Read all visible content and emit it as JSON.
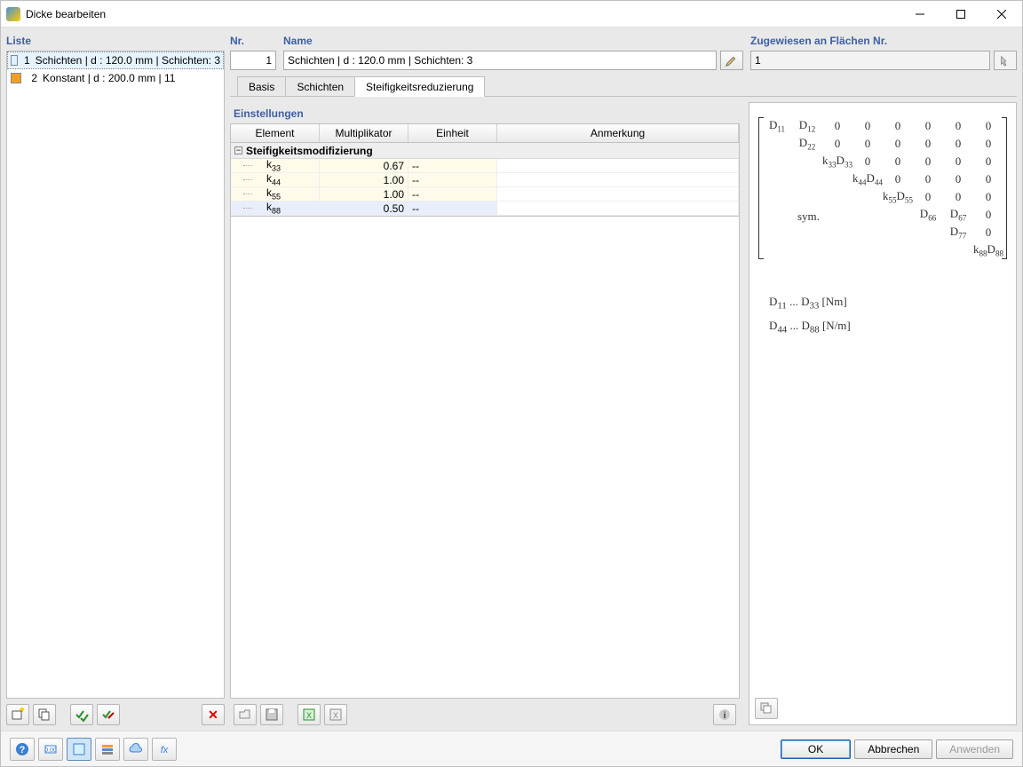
{
  "title": "Dicke bearbeiten",
  "left": {
    "header": "Liste",
    "items": [
      {
        "num": "1",
        "label": "Schichten | d : 120.0 mm | Schichten: 3",
        "color": "blue",
        "selected": true
      },
      {
        "num": "2",
        "label": "Konstant | d : 200.0 mm | 11",
        "color": "orange",
        "selected": false
      }
    ]
  },
  "top": {
    "nr_label": "Nr.",
    "nr_value": "1",
    "name_label": "Name",
    "name_value": "Schichten | d : 120.0 mm | Schichten: 3",
    "assigned_label": "Zugewiesen an Flächen Nr.",
    "assigned_value": "1"
  },
  "tabs": [
    {
      "label": "Basis",
      "active": false
    },
    {
      "label": "Schichten",
      "active": false
    },
    {
      "label": "Steifigkeitsreduzierung",
      "active": true
    }
  ],
  "settings": {
    "title": "Einstellungen",
    "columns": {
      "element": "Element",
      "multiplikator": "Multiplikator",
      "einheit": "Einheit",
      "anmerkung": "Anmerkung"
    },
    "group": "Steifigkeitsmodifizierung",
    "rows": [
      {
        "element_html": "k<sub>33</sub>",
        "mult": "0.67",
        "unit": "--",
        "sel": false
      },
      {
        "element_html": "k<sub>44</sub>",
        "mult": "1.00",
        "unit": "--",
        "sel": false
      },
      {
        "element_html": "k<sub>55</sub>",
        "mult": "1.00",
        "unit": "--",
        "sel": false
      },
      {
        "element_html": "k<sub>88</sub>",
        "mult": "0.50",
        "unit": "--",
        "sel": true
      }
    ]
  },
  "matrix": {
    "sym": "sym.",
    "rows": [
      [
        "D<sub>11</sub>",
        "D<sub>12</sub>",
        "0",
        "0",
        "0",
        "0",
        "0",
        "0"
      ],
      [
        "",
        "D<sub>22</sub>",
        "0",
        "0",
        "0",
        "0",
        "0",
        "0"
      ],
      [
        "",
        "",
        "k<sub>33</sub>D<sub>33</sub>",
        "0",
        "0",
        "0",
        "0",
        "0"
      ],
      [
        "",
        "",
        "",
        "k<sub>44</sub>D<sub>44</sub>",
        "0",
        "0",
        "0",
        "0"
      ],
      [
        "",
        "",
        "",
        "",
        "k<sub>55</sub>D<sub>55</sub>",
        "0",
        "0",
        "0"
      ],
      [
        "",
        "",
        "",
        "",
        "",
        "D<sub>66</sub>",
        "D<sub>67</sub>",
        "0"
      ],
      [
        "",
        "",
        "",
        "",
        "",
        "",
        "D<sub>77</sub>",
        "0"
      ],
      [
        "",
        "",
        "",
        "",
        "",
        "",
        "",
        "k<sub>88</sub>D<sub>88</sub>"
      ]
    ],
    "legend1": "D<sub>11</sub> ... D<sub>33</sub>  [Nm]",
    "legend2": "D<sub>44</sub> ... D<sub>88</sub>  [N/m]"
  },
  "footer": {
    "ok": "OK",
    "cancel": "Abbrechen",
    "apply": "Anwenden"
  }
}
